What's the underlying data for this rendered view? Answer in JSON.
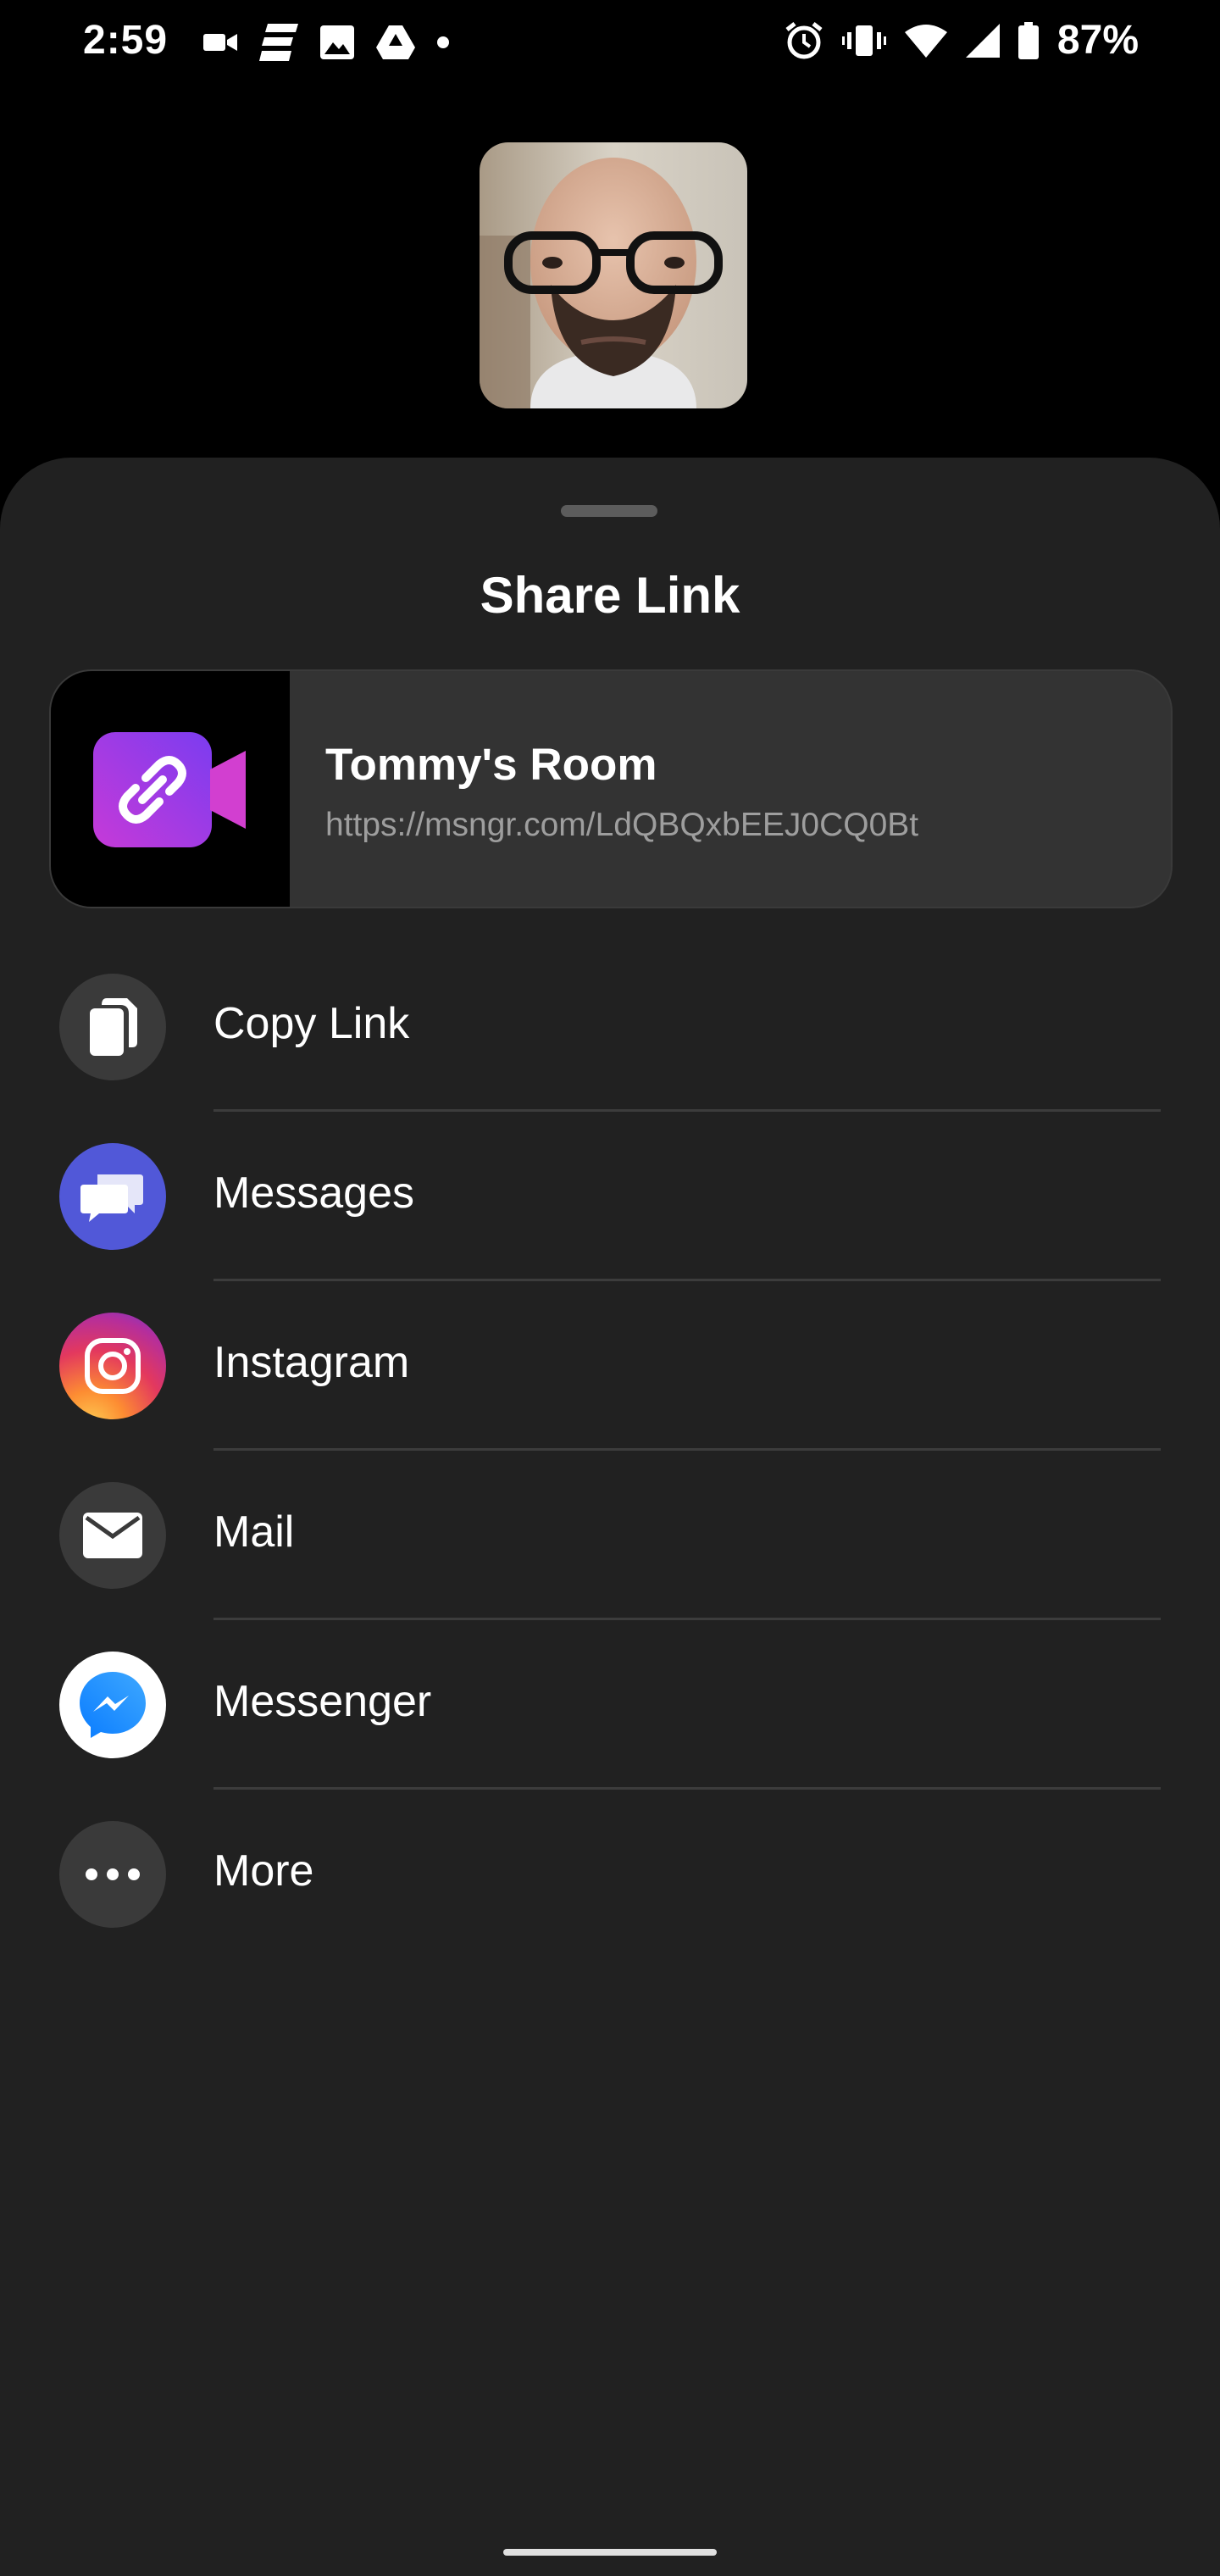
{
  "status_bar": {
    "time": "2:59",
    "battery_percent": "87%",
    "left_icons": [
      "video-camera-icon",
      "espn-icon",
      "image-icon",
      "google-drive-icon",
      "dot-icon"
    ],
    "right_icons": [
      "alarm-icon",
      "vibrate-icon",
      "wifi-icon",
      "cell-signal-icon",
      "battery-icon"
    ]
  },
  "sheet": {
    "title": "Share Link"
  },
  "room": {
    "name": "Tommy's Room",
    "link": "https://msngr.com/LdQBQxbEEJ0CQ0Bt",
    "icon": "room-link-video-icon"
  },
  "share_targets": [
    {
      "label": "Copy Link",
      "icon": "copy-icon",
      "color": "#3a3a3a"
    },
    {
      "label": "Messages",
      "icon": "messages-icon",
      "color": "#5158d8"
    },
    {
      "label": "Instagram",
      "icon": "instagram-icon",
      "color": "#d6246e"
    },
    {
      "label": "Mail",
      "icon": "mail-icon",
      "color": "#3a3a3a"
    },
    {
      "label": "Messenger",
      "icon": "messenger-icon",
      "color": "#ffffff"
    },
    {
      "label": "More",
      "icon": "more-icon",
      "color": "#3a3a3a"
    }
  ]
}
